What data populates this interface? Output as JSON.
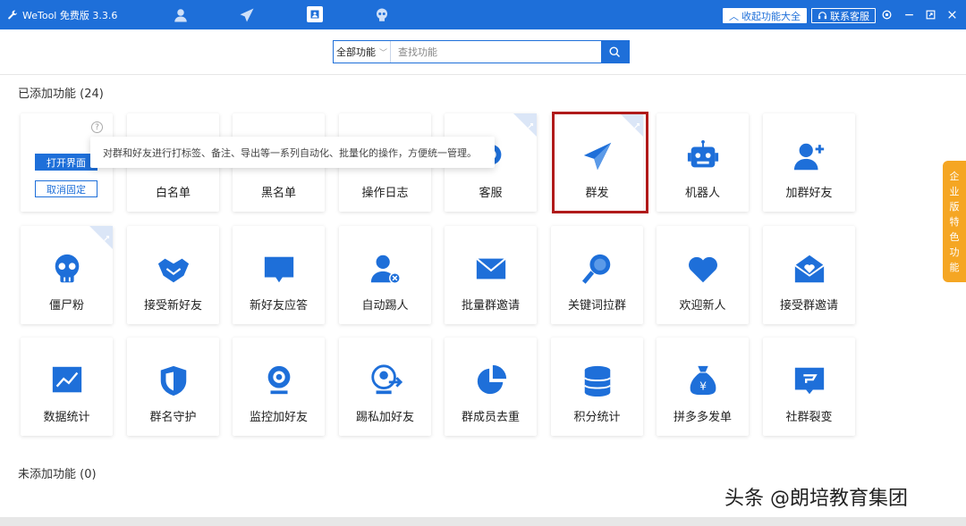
{
  "titlebar": {
    "app_name": "WeTool 免费版 3.3.6",
    "collapse_label": "收起功能大全",
    "support_label": "联系客服",
    "bg_color": "#1e6fd9"
  },
  "search": {
    "scope_label": "全部功能",
    "placeholder": "查找功能"
  },
  "sections": {
    "added_title": "已添加功能 (24)",
    "not_added_title": "未添加功能 (0)"
  },
  "first_card": {
    "open_label": "打开界面",
    "unpin_label": "取消固定",
    "help": "?"
  },
  "tooltip": {
    "text": "对群和好友进行打标签、备注、导出等一系列自动化、批量化的操作，方便统一管理。"
  },
  "cards": [
    {
      "label": "",
      "icon": "tag-icon"
    },
    {
      "label": "白名单",
      "icon": "whitelist-icon"
    },
    {
      "label": "黑名单",
      "icon": "blacklist-icon"
    },
    {
      "label": "操作日志",
      "icon": "log-icon"
    },
    {
      "label": "客服",
      "icon": "service-icon"
    },
    {
      "label": "群发",
      "icon": "paper-plane-icon"
    },
    {
      "label": "机器人",
      "icon": "robot-icon"
    },
    {
      "label": "加群好友",
      "icon": "add-user-icon"
    },
    {
      "label": "僵尸粉",
      "icon": "skull-icon"
    },
    {
      "label": "接受新好友",
      "icon": "handshake-icon"
    },
    {
      "label": "新好友应答",
      "icon": "chat-bubble-icon"
    },
    {
      "label": "自动踢人",
      "icon": "remove-user-icon"
    },
    {
      "label": "批量群邀请",
      "icon": "envelope-icon"
    },
    {
      "label": "关键词拉群",
      "icon": "magnifier-icon"
    },
    {
      "label": "欢迎新人",
      "icon": "heart-icon"
    },
    {
      "label": "接受群邀请",
      "icon": "heart-mail-icon"
    },
    {
      "label": "数据统计",
      "icon": "line-chart-icon"
    },
    {
      "label": "群名守护",
      "icon": "shield-icon"
    },
    {
      "label": "监控加好友",
      "icon": "webcam-icon"
    },
    {
      "label": "踢私加好友",
      "icon": "eject-user-icon"
    },
    {
      "label": "群成员去重",
      "icon": "pie-chart-icon"
    },
    {
      "label": "积分统计",
      "icon": "database-icon"
    },
    {
      "label": "拼多多发单",
      "icon": "money-bag-icon"
    },
    {
      "label": "社群裂变",
      "icon": "fission-icon"
    }
  ],
  "side_tab": [
    "企",
    "业",
    "版",
    "特",
    "色",
    "功",
    "能"
  ],
  "watermark": "头条 @朗培教育集团",
  "accent_color": "#1e6fd9",
  "highlight_color": "#b01a1a",
  "side_tab_color": "#f5a623"
}
